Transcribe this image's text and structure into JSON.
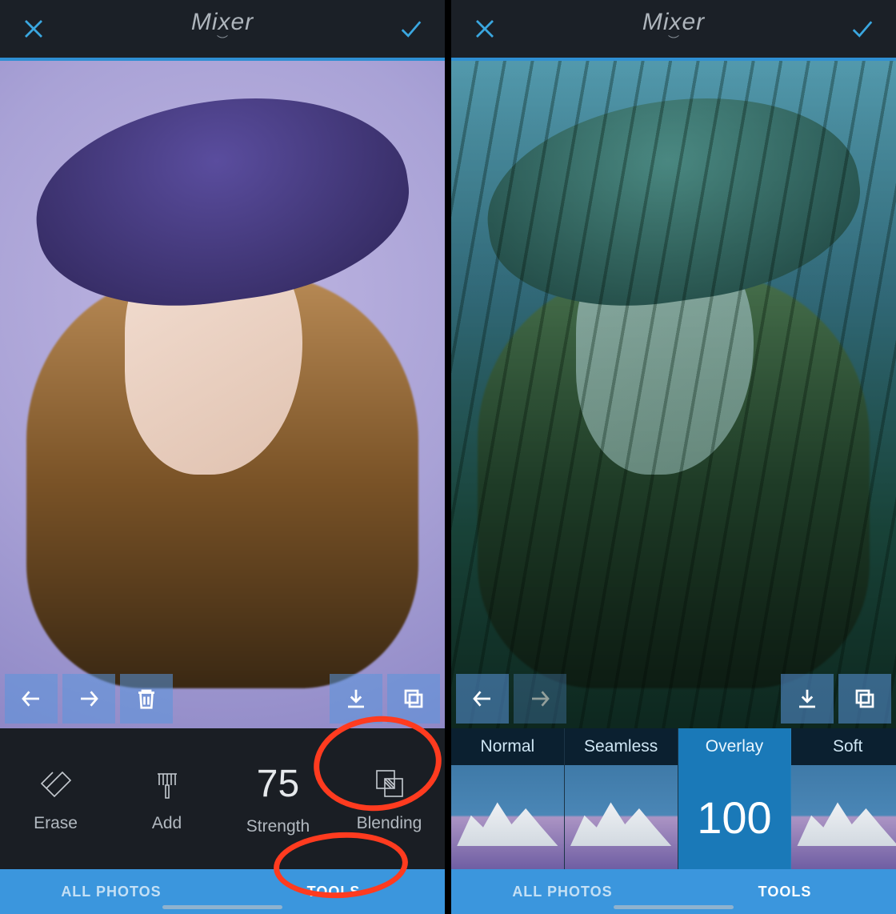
{
  "left": {
    "header": {
      "title": "Mixer"
    },
    "tools": {
      "erase": {
        "label": "Erase"
      },
      "add": {
        "label": "Add"
      },
      "strength": {
        "label": "Strength",
        "value": "75"
      },
      "blending": {
        "label": "Blending"
      }
    },
    "tabs": {
      "all_photos": "ALL PHOTOS",
      "tools": "TOOLS"
    }
  },
  "right": {
    "header": {
      "title": "Mixer"
    },
    "blend_modes": [
      {
        "label": "Normal"
      },
      {
        "label": "Seamless"
      },
      {
        "label": "Overlay",
        "selected": true,
        "value": "100"
      },
      {
        "label": "Soft"
      }
    ],
    "tabs": {
      "all_photos": "ALL PHOTOS",
      "tools": "TOOLS"
    }
  }
}
